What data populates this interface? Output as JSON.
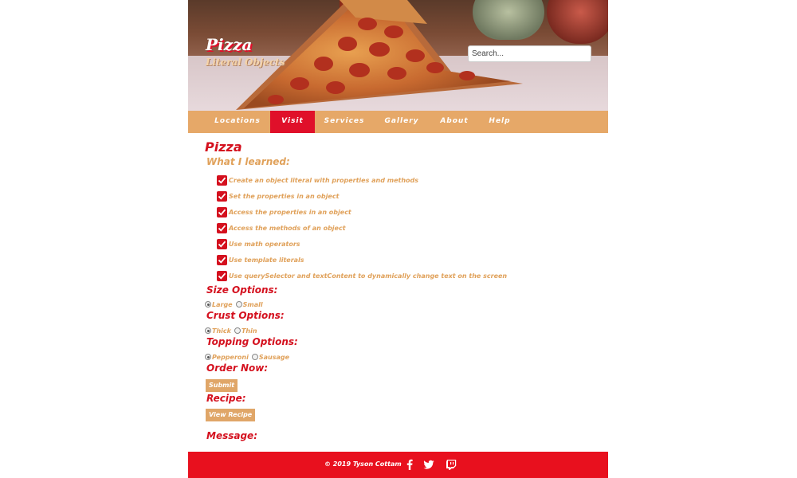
{
  "header": {
    "title": "Pizza",
    "subtitle": "Literal Objects",
    "search_placeholder": "Search..."
  },
  "nav": {
    "items": [
      {
        "label": "Locations",
        "active": false
      },
      {
        "label": "Visit",
        "active": true
      },
      {
        "label": "Services",
        "active": false
      },
      {
        "label": "Gallery",
        "active": false
      },
      {
        "label": "About",
        "active": false
      },
      {
        "label": "Help",
        "active": false
      }
    ]
  },
  "main": {
    "title": "Pizza",
    "learned_heading": "What I learned:",
    "learned_items": [
      "Create an object literal with properties and methods",
      "Set the properties in an object",
      "Access the properties in an object",
      "Access the methods of an object",
      "Use math operators",
      "Use template literals",
      "Use querySelector and textContent to dynamically change text on the screen"
    ],
    "size": {
      "heading": "Size Options:",
      "options": [
        {
          "label": "Large",
          "selected": true
        },
        {
          "label": "Small",
          "selected": false
        }
      ]
    },
    "crust": {
      "heading": "Crust Options:",
      "options": [
        {
          "label": "Thick",
          "selected": true
        },
        {
          "label": "Thin",
          "selected": false
        }
      ]
    },
    "topping": {
      "heading": "Topping Options:",
      "options": [
        {
          "label": "Pepperoni",
          "selected": true
        },
        {
          "label": "Sausage",
          "selected": false
        }
      ]
    },
    "order": {
      "heading": "Order Now:",
      "button": "Submit"
    },
    "recipe": {
      "heading": "Recipe:",
      "button": "View Recipe"
    },
    "message": {
      "heading": "Message:"
    }
  },
  "footer": {
    "copyright": "© 2019 Tyson Cottam",
    "social_icons": [
      "facebook-icon",
      "twitter-icon",
      "twitch-icon"
    ]
  },
  "colors": {
    "brand_red": "#e0102a",
    "accent_orange": "#e6a868",
    "text_orange": "#e0a15a"
  }
}
